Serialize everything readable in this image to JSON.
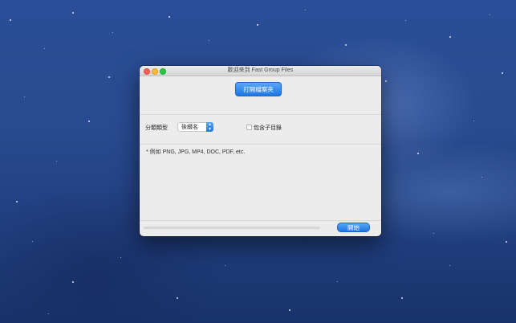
{
  "window": {
    "title": "歡迎來到 Fast Group Files"
  },
  "toolbar": {
    "open_folder_label": "打開檔案夾"
  },
  "options": {
    "category_label": "分類類型",
    "category_value": "後綴名",
    "include_subdirs_label": "包含子目錄",
    "include_subdirs_checked": false
  },
  "info": {
    "example_text": "* 例如 PNG, JPG, MP4, DOC, PDF, etc."
  },
  "footer": {
    "start_label": "開始",
    "progress": 0
  },
  "colors": {
    "accent": "#1d77e4",
    "close": "#fc5f57",
    "minimize": "#fdbc2e",
    "maximize": "#28c840"
  }
}
